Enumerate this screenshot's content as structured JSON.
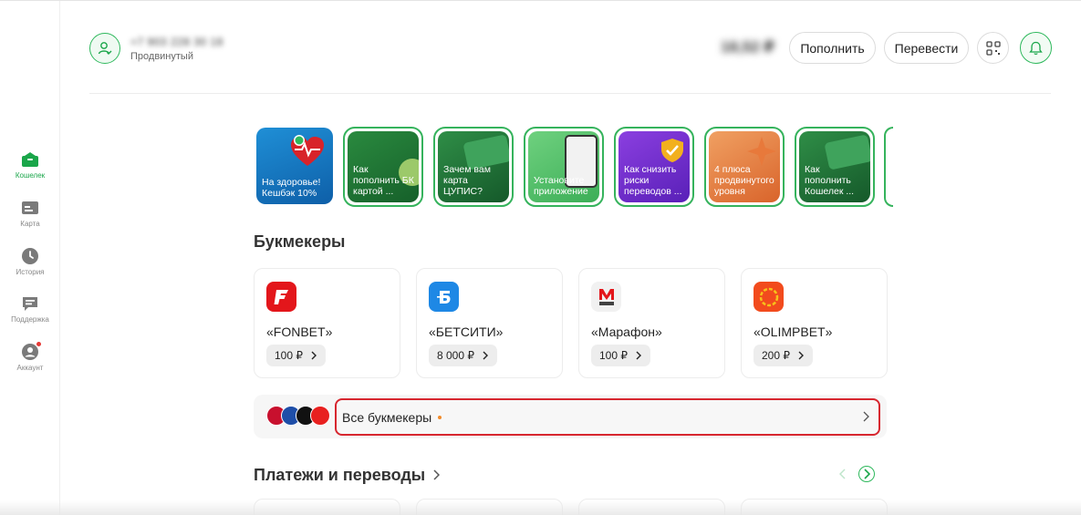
{
  "sidebar": {
    "items": [
      {
        "label": "Кошелек",
        "icon": "wallet-icon",
        "active": true
      },
      {
        "label": "Карта",
        "icon": "card-icon",
        "active": false
      },
      {
        "label": "История",
        "icon": "clock-icon",
        "active": false
      },
      {
        "label": "Поддержка",
        "icon": "chat-icon",
        "active": false
      },
      {
        "label": "Аккаунт",
        "icon": "user-icon",
        "active": false,
        "badge": true
      }
    ]
  },
  "header": {
    "phone": "+7 903 228 30 18",
    "status": "Продвинутый",
    "balance": "18,52 ₽",
    "topup_label": "Пополнить",
    "transfer_label": "Перевести"
  },
  "stories": [
    {
      "text": "На здоровье! Кешбэк 10%"
    },
    {
      "text": "Как пополнить БК картой ..."
    },
    {
      "text": "Зачем вам карта ЦУПИС?"
    },
    {
      "text": "Установите приложение"
    },
    {
      "text": "Как снизить риски переводов ..."
    },
    {
      "text": "4 плюса продвинутого уровня"
    },
    {
      "text": "Как пополнить Кошелек ..."
    }
  ],
  "bookmakers": {
    "title": "Букмекеры",
    "items": [
      {
        "name": "«FONBET»",
        "amount": "100 ₽"
      },
      {
        "name": "«БЕТСИТИ»",
        "amount": "8 000 ₽"
      },
      {
        "name": "«Марафон»",
        "amount": "100 ₽"
      },
      {
        "name": "«OLIMPBET»",
        "amount": "200 ₽"
      }
    ],
    "all_label": "Все букмекеры"
  },
  "payments": {
    "title": "Платежи и переводы"
  },
  "colors": {
    "accent": "#1aa64a",
    "highlight": "#d7262f",
    "fonbet": "#e3161b",
    "betcity": "#1e88e5",
    "olimpbet": "#f24b1d"
  }
}
